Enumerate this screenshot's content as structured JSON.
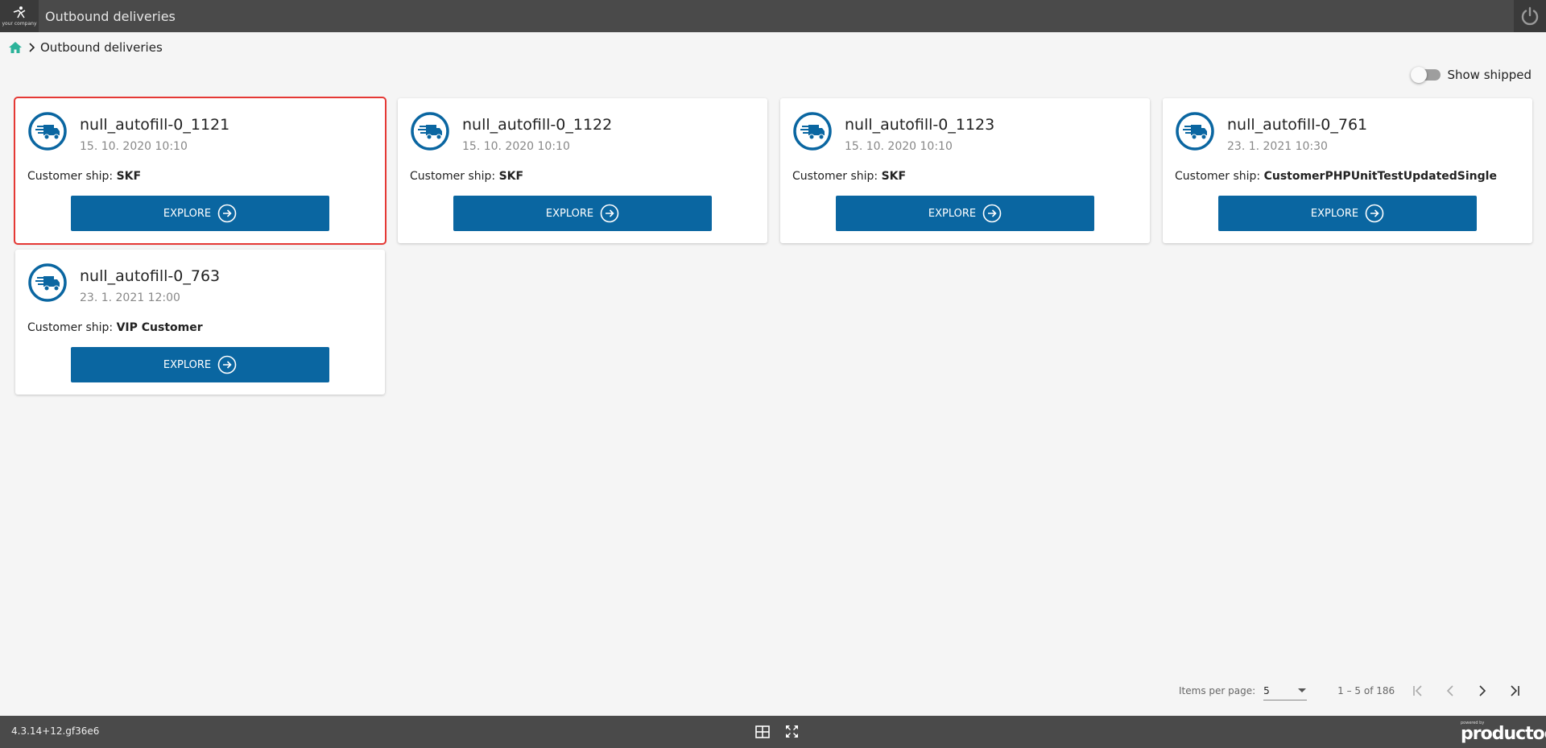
{
  "topbar": {
    "logo_text": "your company",
    "title": "Outbound deliveries"
  },
  "breadcrumb": {
    "current": "Outbound deliveries"
  },
  "filters": {
    "show_shipped_label": "Show shipped",
    "show_shipped": false
  },
  "deliveries": [
    {
      "title": "null_autofill-0_1121",
      "date": "15. 10. 2020 10:10",
      "customer_label": "Customer ship:",
      "customer": "SKF",
      "button": "EXPLORE",
      "selected": true
    },
    {
      "title": "null_autofill-0_1122",
      "date": "15. 10. 2020 10:10",
      "customer_label": "Customer ship:",
      "customer": "SKF",
      "button": "EXPLORE",
      "selected": false
    },
    {
      "title": "null_autofill-0_1123",
      "date": "15. 10. 2020 10:10",
      "customer_label": "Customer ship:",
      "customer": "SKF",
      "button": "EXPLORE",
      "selected": false
    },
    {
      "title": "null_autofill-0_761",
      "date": "23. 1. 2021 10:30",
      "customer_label": "Customer ship:",
      "customer": "CustomerPHPUnitTestUpdatedSingle",
      "button": "EXPLORE",
      "selected": false
    },
    {
      "title": "null_autofill-0_763",
      "date": "23. 1. 2021 12:00",
      "customer_label": "Customer ship:",
      "customer": "VIP Customer",
      "button": "EXPLORE",
      "selected": false
    }
  ],
  "pagination": {
    "items_per_page_label": "Items per page:",
    "items_per_page": "5",
    "range": "1 – 5 of 186"
  },
  "footer": {
    "version": "4.3.14+12.gf36e6",
    "brand_powered": "powered by",
    "brand_name": "productoo"
  },
  "colors": {
    "accent": "#0a66a1",
    "topbar": "#4a4a4a",
    "selection": "#e53935",
    "home_icon": "#2bb39a"
  }
}
